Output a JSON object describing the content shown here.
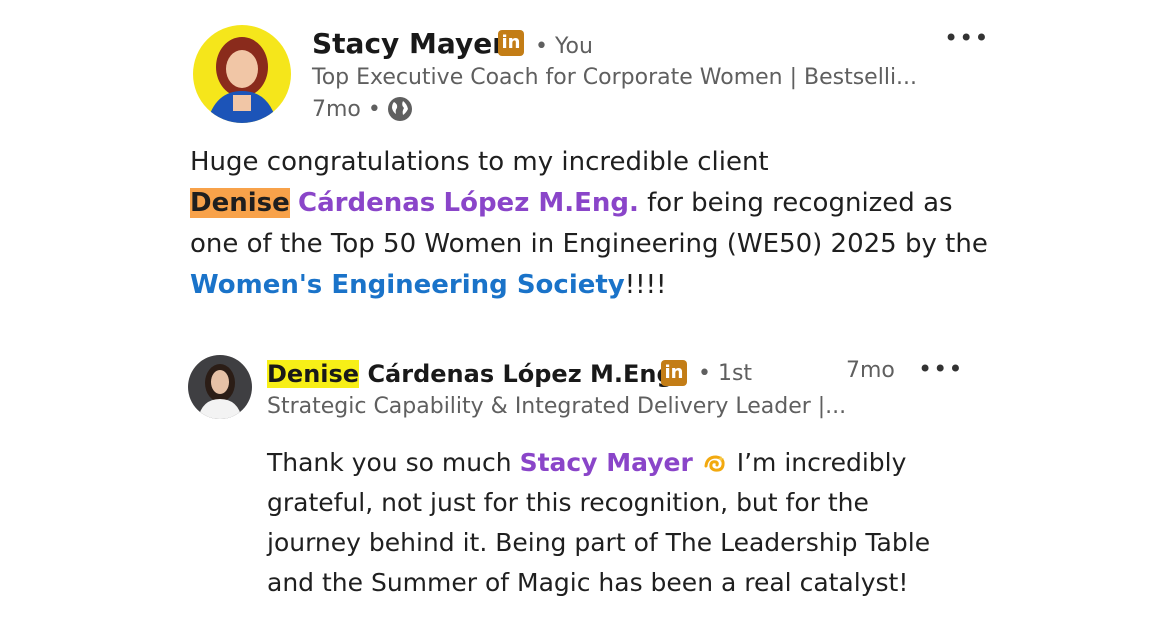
{
  "post": {
    "author_name": "Stacy Mayer",
    "author_badge": "in",
    "author_relation": "• You",
    "author_headline": "Top Executive Coach for Corporate Women | Bestselli...",
    "time": "7mo •",
    "visibility_icon": "globe-icon",
    "menu": "•••",
    "text": {
      "part1": "Huge congratulations to my incredible client ",
      "mention_first": "Denise",
      "mention_rest_line1": "Cárdenas",
      "mention_rest_line2": "López M.Eng.",
      "part2": " for being recognized as one of the Top 50 Women in Engineering (WE50) 2025 by the ",
      "org": "Women's Engineering Society",
      "part3": "!!!!"
    }
  },
  "comment": {
    "author_first": "Denise",
    "author_rest": "Cárdenas López M.Eng.",
    "author_badge": "in",
    "author_degree": "• 1st",
    "author_headline": "Strategic Capability & Integrated Delivery Leader |...",
    "time": "7mo",
    "menu": "•••",
    "text": {
      "part1": "Thank you so much ",
      "mention": "Stacy Mayer",
      "emoji": "dizzy-emoji",
      "part2": " I’m incredibly grateful, not just for this recognition, but for the journey behind it. Being part of The Leadership Table and the Summer of Magic has been a real catalyst!"
    }
  }
}
